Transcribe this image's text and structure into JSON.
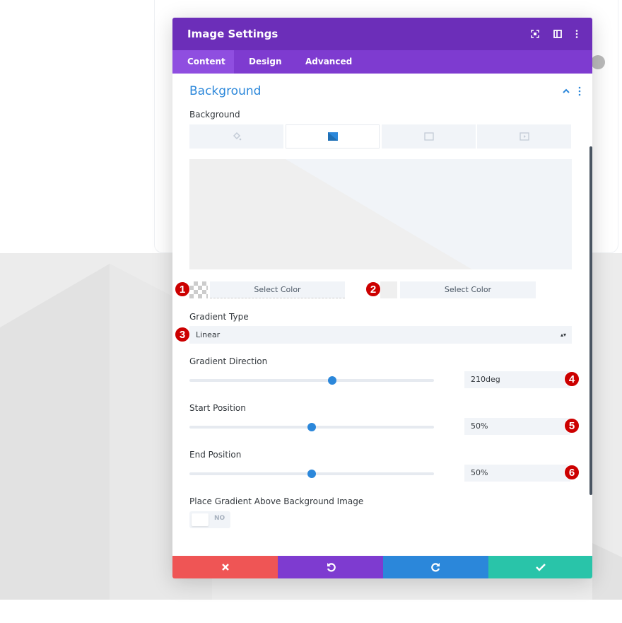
{
  "modal": {
    "title": "Image Settings",
    "header_icons": [
      "fullscreen-icon",
      "split-view-icon",
      "more-options-icon"
    ]
  },
  "tabs": [
    {
      "label": "Content",
      "active": true
    },
    {
      "label": "Design"
    },
    {
      "label": "Advanced"
    }
  ],
  "section": {
    "title": "Background"
  },
  "background": {
    "label": "Background",
    "types": [
      "color-fill-icon",
      "gradient-icon",
      "image-icon",
      "video-icon"
    ],
    "active_type": "gradient-icon"
  },
  "colors": [
    {
      "marker": "1",
      "label": "Select Color"
    },
    {
      "marker": "2",
      "label": "Select Color"
    }
  ],
  "gradient_type": {
    "label": "Gradient Type",
    "value": "Linear",
    "marker": "3"
  },
  "gradient_direction": {
    "label": "Gradient Direction",
    "value": "210deg",
    "numeric": 210,
    "min": 0,
    "max": 360,
    "marker": "4"
  },
  "start_position": {
    "label": "Start Position",
    "value": "50%",
    "numeric": 50,
    "min": 0,
    "max": 100,
    "marker": "5"
  },
  "end_position": {
    "label": "End Position",
    "value": "50%",
    "numeric": 50,
    "min": 0,
    "max": 100,
    "marker": "6"
  },
  "place_above": {
    "label": "Place Gradient Above Background Image",
    "value": "NO"
  },
  "footer": [
    "close-icon",
    "undo-icon",
    "redo-icon",
    "check-icon"
  ],
  "theme": {
    "header": "#6c2eb9",
    "tabs": "#7e3bd0",
    "accent": "#2b87da",
    "cancel": "#ef5555",
    "undo": "#7e3bd0",
    "redo": "#2b87da",
    "save": "#29c4a9",
    "marker": "#cc0000"
  }
}
